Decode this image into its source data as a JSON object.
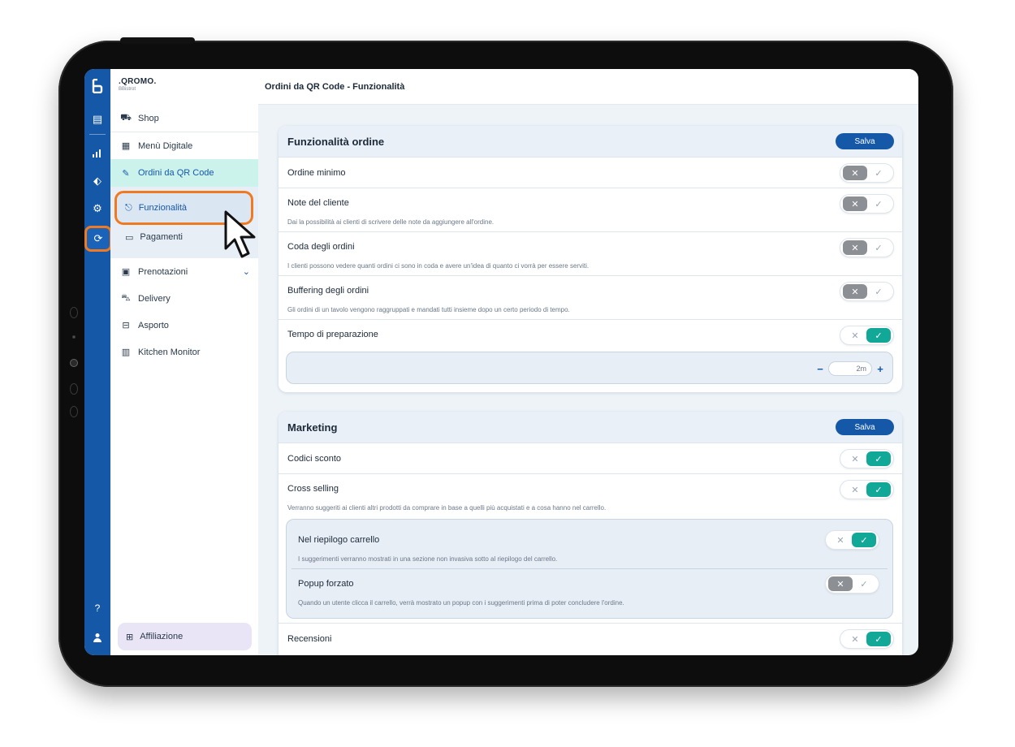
{
  "app": {
    "brand_name": ".QROMO.",
    "brand_sub": "BBistrot",
    "page_title": "Ordini da QR Code - Funzionalità"
  },
  "colors": {
    "primary": "#1558a8",
    "accent_teal": "#12a898",
    "highlight_orange": "#ef7a22",
    "active_nav_bg": "#ccf2ec"
  },
  "rail": {
    "logo_icon": "brand-logo-icon",
    "icons": [
      "menu-book-icon",
      "stats-icon",
      "marketing-icon",
      "settings-gear-icon",
      "qr-orders-icon"
    ],
    "bottom_icons": [
      "help-icon",
      "user-icon"
    ]
  },
  "sidebar": {
    "items": [
      {
        "label": "Shop",
        "icon": "cart-icon"
      },
      {
        "label": "Menù Digitale",
        "icon": "menu-board-icon"
      },
      {
        "label": "Ordini da QR Code",
        "icon": "qr-order-icon"
      },
      {
        "label": "Prenotazioni",
        "icon": "calendar-icon"
      },
      {
        "label": "Delivery",
        "icon": "scooter-icon"
      },
      {
        "label": "Asporto",
        "icon": "takeaway-bag-icon"
      },
      {
        "label": "Kitchen Monitor",
        "icon": "monitor-icon"
      }
    ],
    "sub_items": [
      {
        "label": "Funzionalità",
        "icon": "features-icon"
      },
      {
        "label": "Pagamenti",
        "icon": "card-icon"
      }
    ],
    "affiliation_label": "Affiliazione"
  },
  "order_features": {
    "title": "Funzionalità ordine",
    "save_label": "Salva",
    "rows": [
      {
        "label": "Ordine minimo",
        "description": "",
        "enabled": false
      },
      {
        "label": "Note del cliente",
        "description": "Dai la possibilità ai clienti di scrivere delle note da aggiungere all'ordine.",
        "enabled": false
      },
      {
        "label": "Coda degli ordini",
        "description": "I clienti possono vedere quanti ordini ci sono in coda e avere un'idea di quanto ci vorrà per essere serviti.",
        "enabled": false
      },
      {
        "label": "Buffering degli ordini",
        "description": "Gli ordini di un tavolo vengono raggruppati e mandati tutti insieme dopo un certo periodo di tempo.",
        "enabled": false
      },
      {
        "label": "Tempo di preparazione",
        "description": "",
        "enabled": true
      }
    ],
    "prep_time": {
      "value": "2m",
      "minus": "−",
      "plus": "+"
    }
  },
  "marketing": {
    "title": "Marketing",
    "save_label": "Salva",
    "rows": [
      {
        "label": "Codici sconto",
        "description": "",
        "enabled": true
      },
      {
        "label": "Cross selling",
        "description": "Verranno suggeriti ai clienti altri prodotti da comprare in base a quelli più acquistati e a cosa hanno nel carrello.",
        "enabled": true
      },
      {
        "label": "Recensioni",
        "description": "",
        "enabled": true
      }
    ],
    "cross_selling_options": [
      {
        "label": "Nel riepilogo carrello",
        "description": "I suggerimenti verranno mostrati in una sezione non invasiva sotto al riepilogo del carrello.",
        "enabled": true
      },
      {
        "label": "Popup forzato",
        "description": "Quando un utente clicca il carrello, verrà mostrato un popup con i suggerimenti prima di poter concludere l'ordine.",
        "enabled": false
      }
    ]
  },
  "toggle_glyphs": {
    "off": "✕",
    "on": "✓"
  }
}
